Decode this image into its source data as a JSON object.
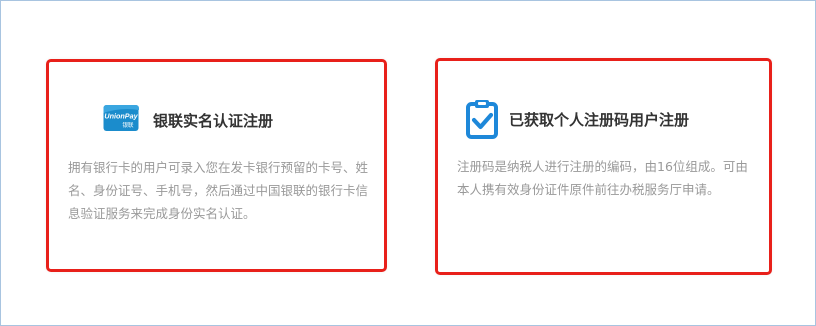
{
  "colors": {
    "highlight_border": "#e8201a",
    "frame_border": "#a8c4e0",
    "title_text": "#333333",
    "desc_text": "#999999",
    "icon_blue": "#1e88d9",
    "unionpay_bg": "#1b8ccc"
  },
  "cards": [
    {
      "icon": "unionpay-card-icon",
      "icon_text_top": "UnionPay",
      "icon_text_bottom": "银联",
      "title": "银联实名认证注册",
      "description": "拥有银行卡的用户可录入您在发卡银行预留的卡号、姓名、身份证号、手机号，然后通过中国银联的银行卡信息验证服务来完成身份实名认证。"
    },
    {
      "icon": "clipboard-check-icon",
      "title": "已获取个人注册码用户注册",
      "description": "注册码是纳税人进行注册的编码，由16位组成。可由本人携有效身份证件原件前往办税服务厅申请。"
    }
  ]
}
